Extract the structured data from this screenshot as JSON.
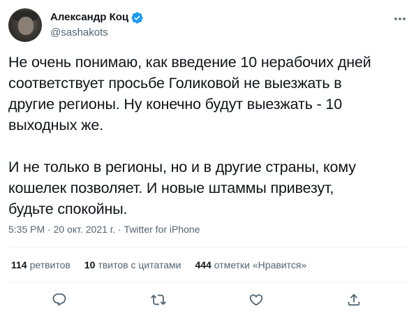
{
  "author": {
    "name": "Александр Коц",
    "handle": "@sashakots",
    "verified_icon": "verified-badge-icon",
    "avatar": "avatar"
  },
  "tweet": {
    "text": "Не очень понимаю, как введение 10 нерабочих дней\nсоответствует просьбе Голиковой не выезжать в\nдругие регионы. Ну конечно будут выезжать - 10\nвыходных же.\n\nИ не только в регионы, но и в другие страны, кому\nкошелек позволяет. И новые штаммы привезут,\nбудьте спокойны."
  },
  "meta": {
    "time": "5:35 PM",
    "sep1": " · ",
    "date": "20 окт. 2021 г.",
    "sep2": " · ",
    "source": "Twitter for iPhone"
  },
  "stats": {
    "retweets_count": "114",
    "retweets_label": "ретвитов",
    "quotes_count": "10",
    "quotes_label": "твитов с цитатами",
    "likes_count": "444",
    "likes_label": "отметки «Нравится»"
  },
  "colors": {
    "verified": "#1d9bf0",
    "text": "#0f1419",
    "secondary": "#536471",
    "divider": "#eff3f4"
  },
  "icons": {
    "more": "more-icon",
    "reply": "reply-icon",
    "retweet": "retweet-icon",
    "like": "like-icon",
    "share": "share-icon"
  }
}
